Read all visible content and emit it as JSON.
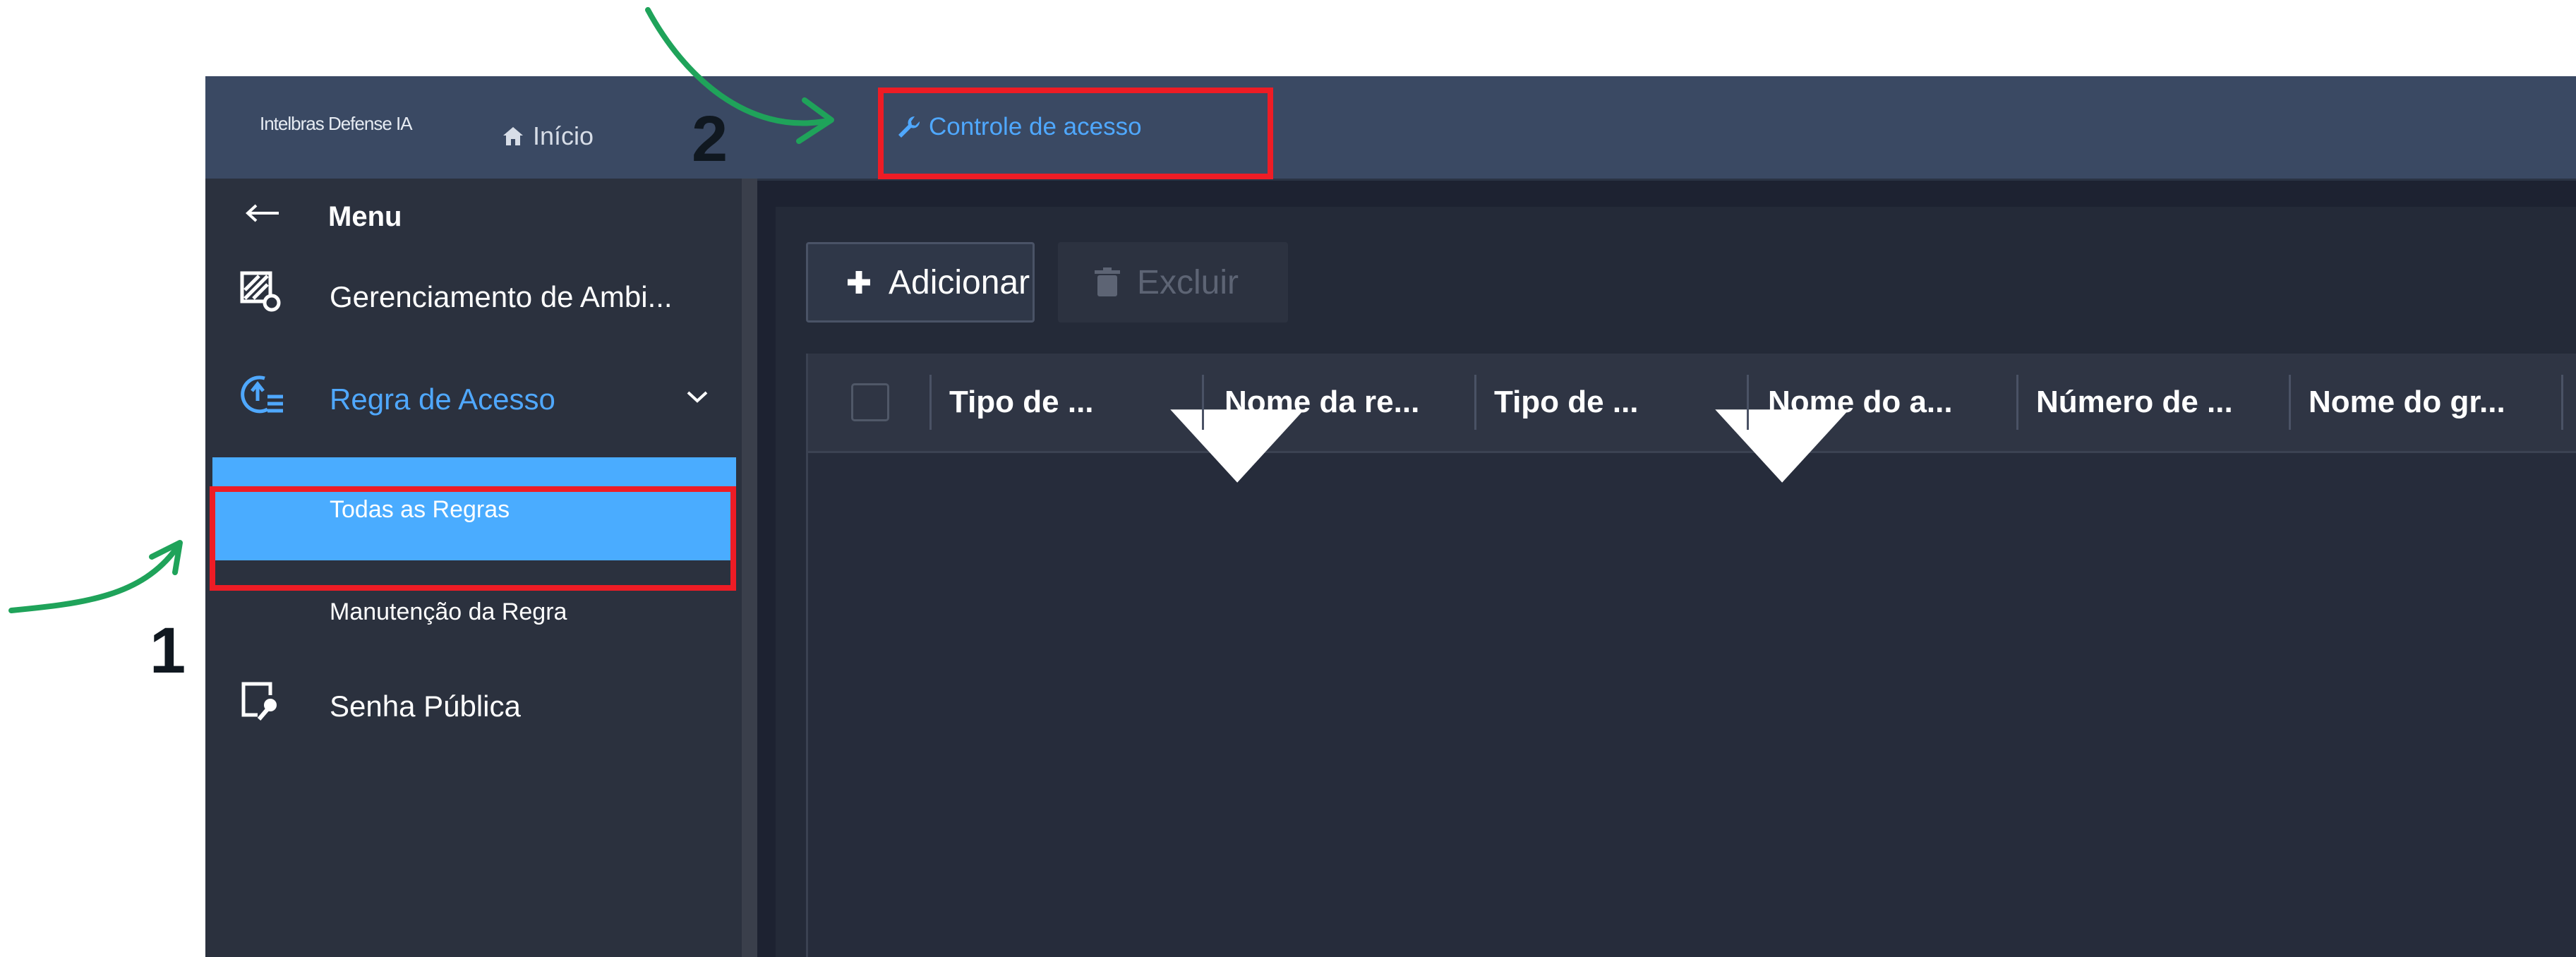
{
  "topbar": {
    "brand": "Intelbras Defense IA",
    "home_label": "Início",
    "active_tab_label": "Controle de acesso"
  },
  "sidebar": {
    "menu_label": "Menu",
    "items": [
      {
        "label": "Gerenciamento de Ambi...",
        "icon": "environment-icon"
      },
      {
        "label": "Regra de Acesso",
        "icon": "access-rule-icon",
        "expanded": true
      },
      {
        "label": "Senha Pública",
        "icon": "public-password-icon"
      }
    ],
    "subitems": [
      {
        "label": "Todas as Regras",
        "selected": true
      },
      {
        "label": "Manutenção da Regra",
        "selected": false
      }
    ]
  },
  "toolbar": {
    "add_label": "Adicionar",
    "delete_label": "Excluir"
  },
  "table": {
    "columns": [
      "Tipo de ...",
      "Nome da re...",
      "Tipo de ...",
      "Nome do a...",
      "Número de ...",
      "Nome do gr..."
    ]
  },
  "annotations": {
    "label_1": "1",
    "label_2": "2"
  },
  "colors": {
    "accent": "#4aacff",
    "highlight_border": "#ee1c25",
    "arrow": "#1fa35a",
    "topbar": "#3a4963",
    "sidebar": "#2b313e"
  }
}
